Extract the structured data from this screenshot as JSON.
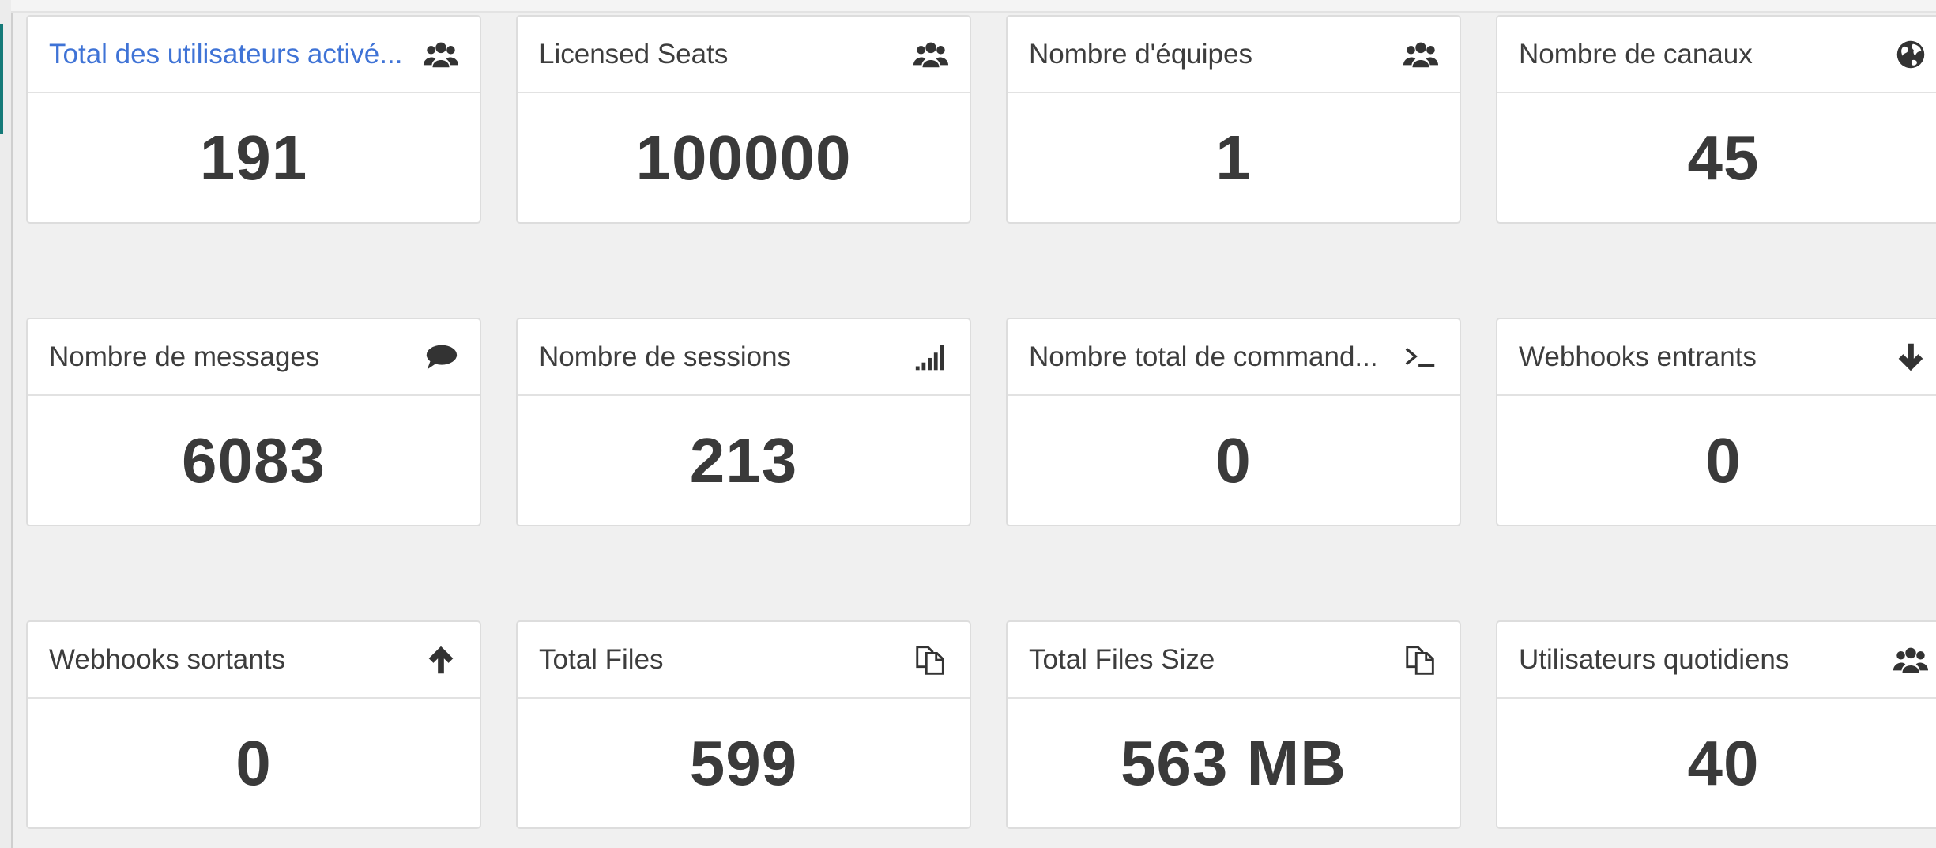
{
  "stats": [
    {
      "title": "Total des utilisateurs activé...",
      "value": "191",
      "icon": "users-icon",
      "link": true
    },
    {
      "title": "Licensed Seats",
      "value": "100000",
      "icon": "users-icon",
      "link": false
    },
    {
      "title": "Nombre d'équipes",
      "value": "1",
      "icon": "users-icon",
      "link": false
    },
    {
      "title": "Nombre de canaux",
      "value": "45",
      "icon": "globe-icon",
      "link": false
    },
    {
      "title": "Nombre de messages",
      "value": "6083",
      "icon": "comment-icon",
      "link": false
    },
    {
      "title": "Nombre de sessions",
      "value": "213",
      "icon": "signal-icon",
      "link": false
    },
    {
      "title": "Nombre total de command...",
      "value": "0",
      "icon": "terminal-icon",
      "link": false
    },
    {
      "title": "Webhooks entrants",
      "value": "0",
      "icon": "arrow-down-icon",
      "link": false
    },
    {
      "title": "Webhooks sortants",
      "value": "0",
      "icon": "arrow-up-icon",
      "link": false
    },
    {
      "title": "Total Files",
      "value": "599",
      "icon": "files-icon",
      "link": false
    },
    {
      "title": "Total Files Size",
      "value": "563 MB",
      "icon": "files-icon",
      "link": false
    },
    {
      "title": "Utilisateurs quotidiens",
      "value": "40",
      "icon": "users-icon",
      "link": false
    }
  ],
  "colors": {
    "link": "#3f73d6",
    "accent": "#157a78",
    "background": "#f0f0f0"
  }
}
